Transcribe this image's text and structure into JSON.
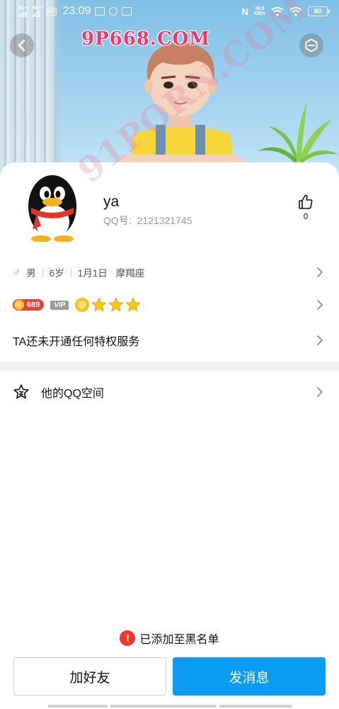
{
  "status_bar": {
    "sim1": "4G+",
    "sim2": "4G+",
    "hd": "HD",
    "time": "23:09",
    "nfc": "N",
    "net_speed_value": "34.5",
    "net_speed_unit": "KB/s",
    "battery": "80"
  },
  "header": {
    "watermark_top": "9P668.COM",
    "watermark_diagonal": "91PORN.COM",
    "back_icon": "chevron-left-icon",
    "theme_icon": "hexagon-theme-icon"
  },
  "profile": {
    "name": "ya",
    "qq_label": "QQ号:",
    "qq_number": "2121321745",
    "like_count": "0"
  },
  "info": {
    "gender": "男",
    "age": "6岁",
    "birthday": "1月1日",
    "zodiac": "摩羯座"
  },
  "badges": {
    "level": "689",
    "vip": "VIP",
    "star_count": 4
  },
  "privilege": {
    "text": "TA还未开通任何特权服务"
  },
  "qzone": {
    "label": "他的QQ空间"
  },
  "footer": {
    "blacklist_notice": "已添加至黑名单",
    "add_friend": "加好友",
    "send_message": "发消息"
  },
  "colors": {
    "accent_blue": "#0a9cf5",
    "warning_red": "#f2362f",
    "level_red": "#e5413b"
  }
}
